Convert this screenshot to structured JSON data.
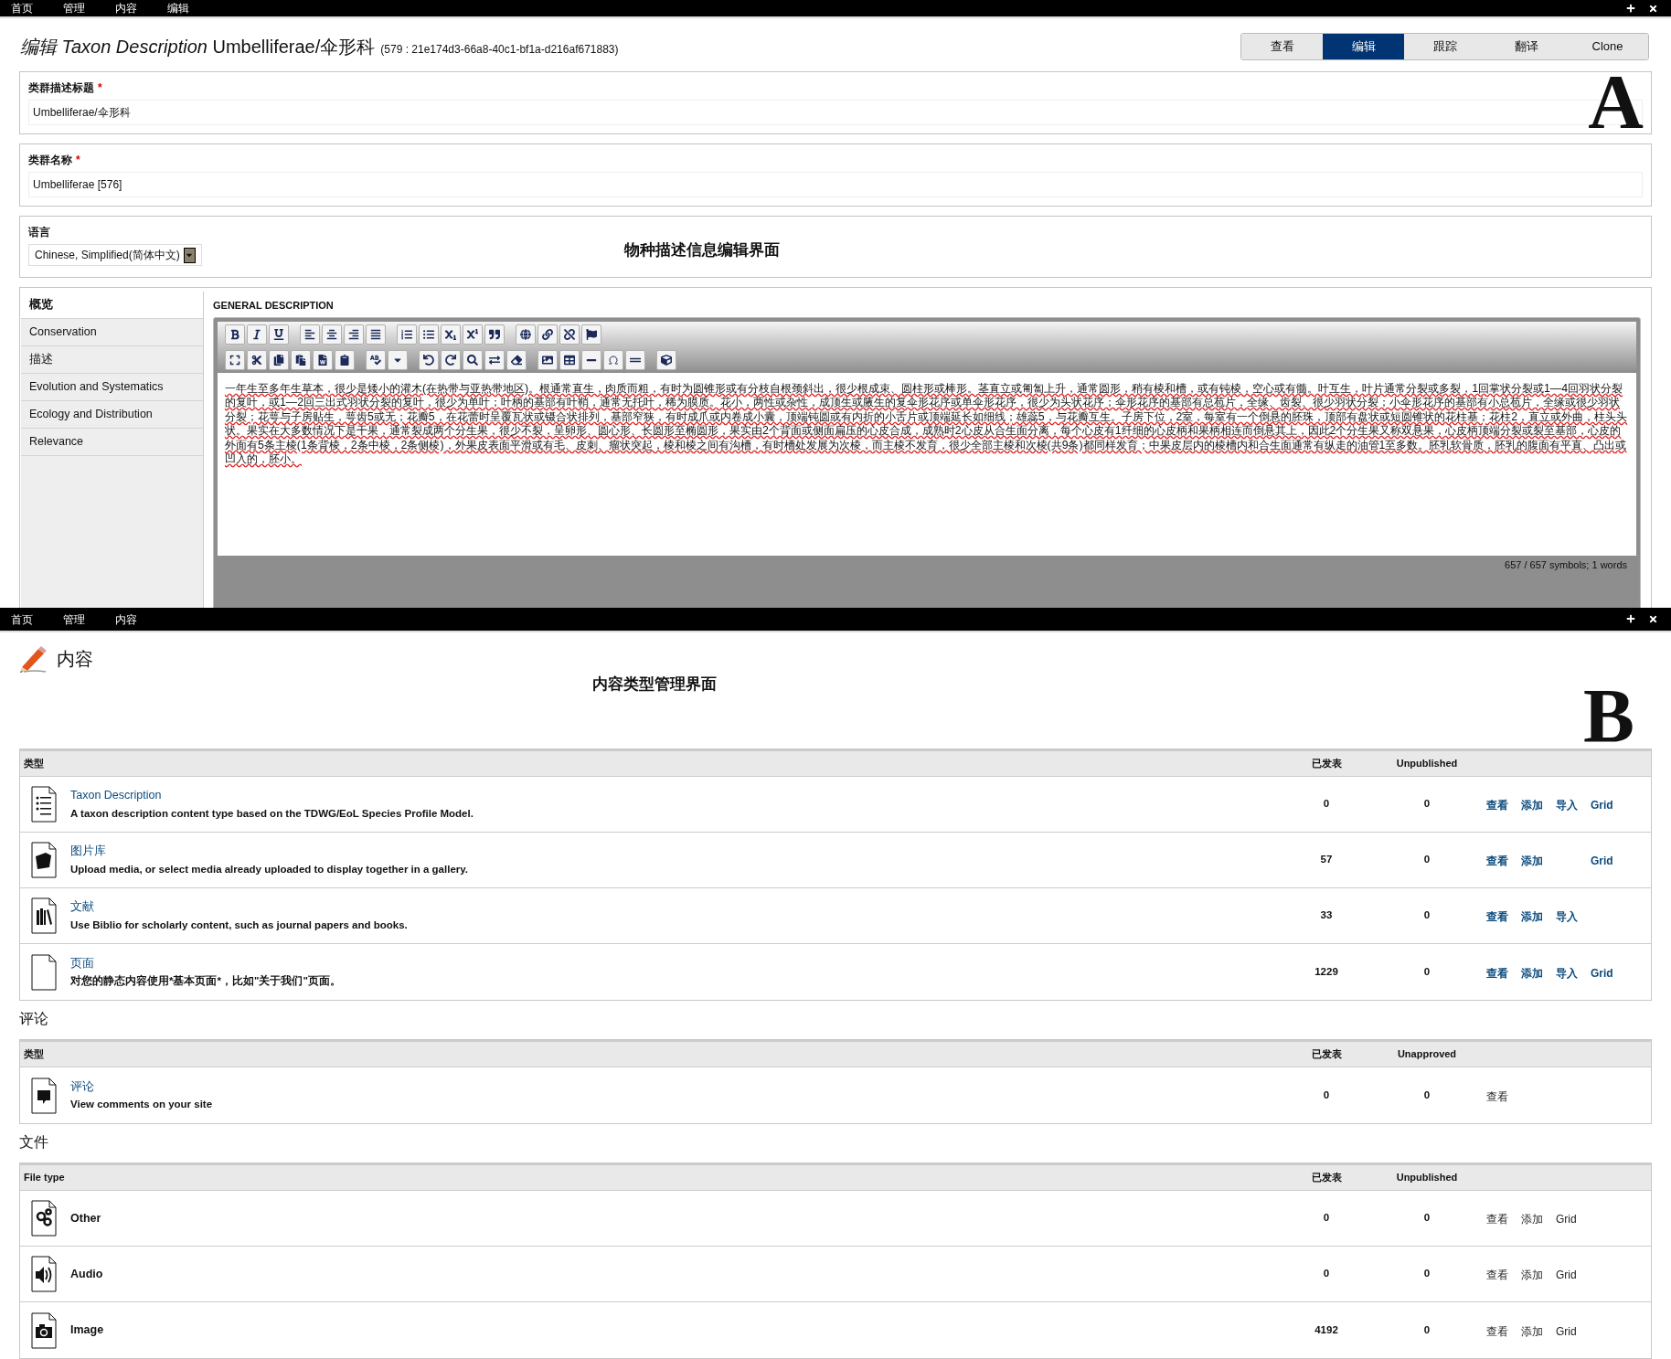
{
  "panel_a": {
    "menu": [
      "首页",
      "管理",
      "内容",
      "编辑"
    ],
    "title": "*编辑 Taxon Description* Umbelliferae/伞形科",
    "node_id": "(579 : 21e174d3-66a8-40c1-bf1a-d216af671883)",
    "tabs": [
      {
        "label": "查看",
        "selected": false
      },
      {
        "label": "编辑",
        "selected": true
      },
      {
        "label": "跟踪",
        "selected": false
      },
      {
        "label": "翻译",
        "selected": false
      },
      {
        "label": "Clone",
        "selected": false
      }
    ],
    "figure_label": "A",
    "fields": [
      {
        "label": "类群描述标题",
        "required_mark": "*",
        "value": "Umbelliferae/伞形科"
      },
      {
        "label": "类群名称",
        "required_mark": "*",
        "value": "Umbelliferae [576]"
      }
    ],
    "language": {
      "label": "语言",
      "value": "Chinese, Simplified(简体中文)"
    },
    "caption": "物种描述信息编辑界面",
    "sidebar": [
      {
        "label": "概览",
        "selected": true
      },
      {
        "label": "Conservation",
        "selected": false
      },
      {
        "label": "描述",
        "selected": false
      },
      {
        "label": "Evolution and Systematics",
        "selected": false
      },
      {
        "label": "Ecology and Distribution",
        "selected": false
      },
      {
        "label": "Relevance",
        "selected": false
      }
    ],
    "editor": {
      "heading": "GENERAL DESCRIPTION",
      "text": "一年生至多年生草本，很少是矮小的灌木(在热带与亚热带地区)。根通常直生，肉质而粗，有时为圆锥形或有分枝自根颈斜出，很少根成束、圆柱形或棒形。茎直立或匍匐上升，通常圆形，稍有棱和槽，或有钝棱，空心或有髓。叶互生，叶片通常分裂或多裂，1回掌状分裂或1—4回羽状分裂的复叶，或1—2回三出式羽状分裂的复叶，很少为单叶；叶柄的基部有叶鞘，通常无托叶，稀为膜质。花小，两性或杂性，成顶生或腋生的复伞形花序或单伞形花序，很少为头状花序；伞形花序的基部有总苞片，全缘、齿裂、很少羽状分裂；小伞形花序的基部有小总苞片，全缘或很少羽状分裂；花萼与子房贴生，萼齿5或无；花瓣5，在花蕾时呈覆瓦状或镊合状排列，基部窄狭，有时成爪或内卷成小囊，顶端钝圆或有内折的小舌片或顶端延长如细线；雄蕊5，与花瓣互生。子房下位，2室，每室有一个倒悬的胚珠，顶部有盘状或短圆锥状的花柱基；花柱2，直立或外曲，柱头头状。果实在大多数情况下是干果，通常裂成两个分生果，很少不裂，呈卵形、圆心形、长圆形至椭圆形，果实由2个背面或侧面扁压的心皮合成，成熟时2心皮从合生面分离，每个心皮有1纤细的心皮柄和果柄相连而倒悬其上，因此2个分生果又称双悬果，心皮柄顶端分裂或裂至基部，心皮的外面有5条主棱(1条背棱，2条中棱，2条侧棱)，外果皮表面平滑或有毛、皮刺、瘤状突起，棱和棱之间有沟槽，有时槽处发展为次棱，而主棱不发育，很少全部主棱和次棱(共9条)都同样发育；中果皮层内的棱槽内和合生面通常有纵走的油管1至多数。胚乳软骨质，胚乳的腹面有平直、凸出或凹入的，胚小。",
      "status": "657 / 657 symbols; 1 words"
    }
  },
  "panel_b": {
    "menu": [
      "首页",
      "管理",
      "内容"
    ],
    "heading": "内容",
    "caption": "内容类型管理界面",
    "figure_label": "B",
    "sections": [
      {
        "kind": "content",
        "columns": [
          "类型",
          "已发表",
          "Unpublished"
        ],
        "rows": [
          {
            "kind": "list",
            "title": "Taxon Description",
            "description": "A taxon description content type based on the TDWG/EoL Species Profile Model.",
            "published": "0",
            "unpublished": "0",
            "actions": [
              {
                "kind": "view",
                "label": "查看"
              },
              {
                "kind": "add",
                "label": "添加"
              },
              {
                "kind": "import",
                "label": "导入"
              },
              {
                "kind": "grid",
                "label": "Grid"
              }
            ]
          },
          {
            "kind": "gallery",
            "title": "图片库",
            "description": "Upload media, or select media already uploaded to display together in a gallery.",
            "published": "57",
            "unpublished": "0",
            "actions": [
              {
                "kind": "view",
                "label": "查看"
              },
              {
                "kind": "add",
                "label": "添加"
              },
              {
                "kind": "grid",
                "label": "Grid"
              }
            ]
          },
          {
            "kind": "books",
            "title": "文献",
            "description": "Use Biblio for scholarly content, such as journal papers and books.",
            "published": "33",
            "unpublished": "0",
            "actions": [
              {
                "kind": "view",
                "label": "查看"
              },
              {
                "kind": "add",
                "label": "添加"
              },
              {
                "kind": "import",
                "label": "导入"
              }
            ]
          },
          {
            "kind": "page",
            "title": "页面",
            "description": "对您的静态内容使用*基本页面*，比如\"关于我们\"页面。",
            "published": "1229",
            "unpublished": "0",
            "actions": [
              {
                "kind": "view",
                "label": "查看"
              },
              {
                "kind": "add",
                "label": "添加"
              },
              {
                "kind": "import",
                "label": "导入"
              },
              {
                "kind": "grid",
                "label": "Grid"
              }
            ]
          }
        ]
      },
      {
        "kind": "comment",
        "heading": "评论",
        "columns": [
          "类型",
          "已发表",
          "Unapproved"
        ],
        "rows": [
          {
            "kind": "comment",
            "title": "评论",
            "description": "View comments on your site",
            "published": "0",
            "unpublished": "0",
            "actions": [
              {
                "kind": "view",
                "label": "查看"
              }
            ]
          }
        ]
      },
      {
        "kind": "file",
        "heading": "文件",
        "columns": [
          "File type",
          "已发表",
          "Unpublished"
        ],
        "rows": [
          {
            "kind": "gears",
            "title": "Other",
            "published": "0",
            "unpublished": "0",
            "actions": [
              {
                "kind": "view",
                "label": "查看"
              },
              {
                "kind": "add",
                "label": "添加"
              },
              {
                "kind": "grid",
                "label": "Grid"
              }
            ]
          },
          {
            "kind": "audio",
            "title": "Audio",
            "published": "0",
            "unpublished": "0",
            "actions": [
              {
                "kind": "view",
                "label": "查看"
              },
              {
                "kind": "add",
                "label": "添加"
              },
              {
                "kind": "grid",
                "label": "Grid"
              }
            ]
          },
          {
            "kind": "camera",
            "title": "Image",
            "published": "4192",
            "unpublished": "0",
            "actions": [
              {
                "kind": "view",
                "label": "查看"
              },
              {
                "kind": "add",
                "label": "添加"
              },
              {
                "kind": "grid",
                "label": "Grid"
              }
            ]
          }
        ]
      }
    ]
  }
}
